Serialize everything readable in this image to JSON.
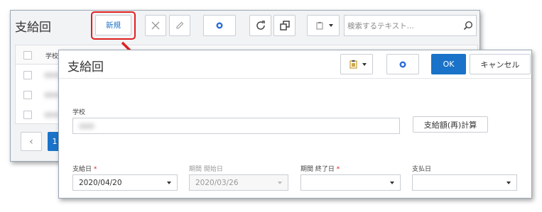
{
  "back_window": {
    "title": "支給回",
    "new_button": "新規",
    "search_placeholder": "検索するテキスト...",
    "header_school_label": "学校",
    "pager_first_label": "1",
    "highlight_color": "#e02020"
  },
  "dialog": {
    "title": "支給回",
    "ok_label": "OK",
    "cancel_label": "キャンセル",
    "school_label": "学校",
    "recalc_button": "支給額(再)計算",
    "payment_date_label": "支給日",
    "period_start_label": "期間 開始日",
    "period_start_value": "2020/03/26",
    "period_end_label": "期間 終了日",
    "pay_date_label": "支払日",
    "payment_date_value": "2020/04/20",
    "required_mark": "*",
    "accent_color": "#1a73c8"
  }
}
